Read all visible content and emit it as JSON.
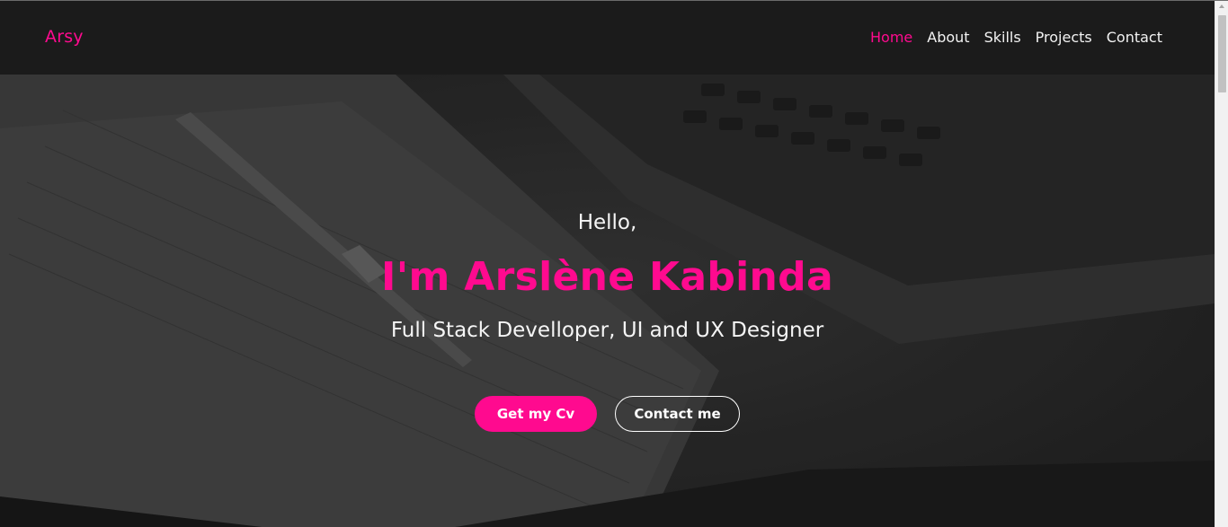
{
  "navbar": {
    "brand": "Arsy",
    "links": [
      {
        "label": "Home",
        "active": true
      },
      {
        "label": "About",
        "active": false
      },
      {
        "label": "Skills",
        "active": false
      },
      {
        "label": "Projects",
        "active": false
      },
      {
        "label": "Contact",
        "active": false
      }
    ]
  },
  "hero": {
    "greeting": "Hello,",
    "headline": "I'm Arslène Kabinda",
    "subtitle": "Full Stack Develloper, UI and UX Designer",
    "primary_button": "Get my Cv",
    "secondary_button": "Contact me"
  },
  "colors": {
    "accent": "#ff0a8f",
    "navbar_bg": "#1b1b1b",
    "text": "#f5f5f5"
  }
}
